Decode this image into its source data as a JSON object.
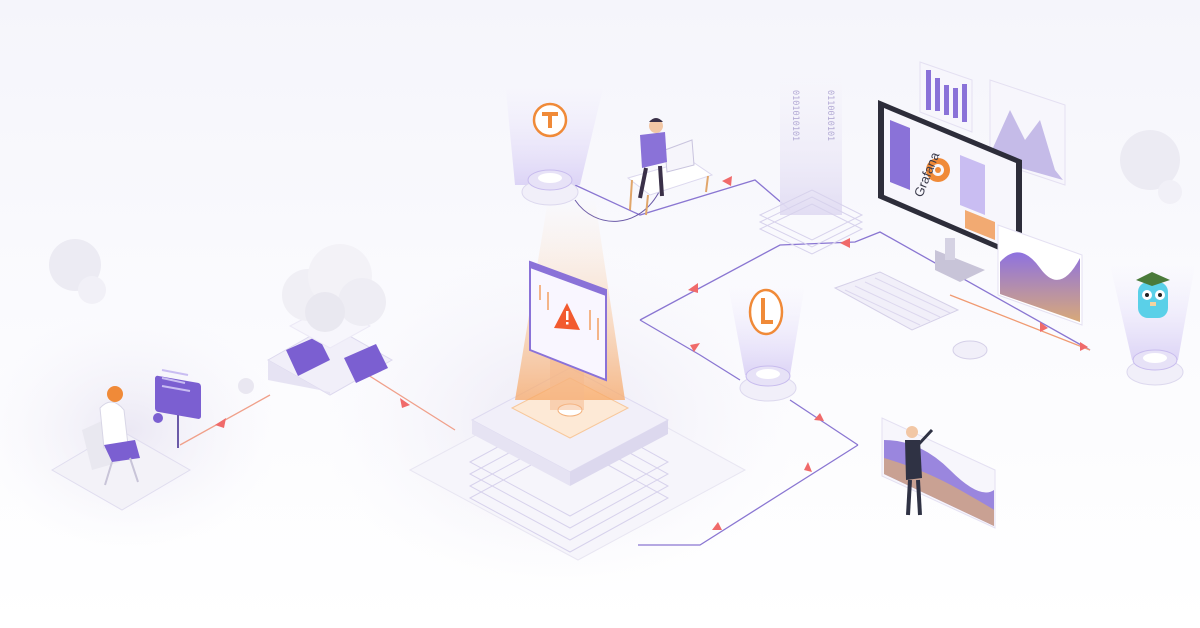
{
  "monitor": {
    "brand_text": "Grafana"
  },
  "servers": {
    "binary_left": "0101010101",
    "binary_right": "0110010101"
  },
  "colors": {
    "purple": "#7c5cd6",
    "purple_light": "#c9bdf2",
    "orange": "#f08a38",
    "arrow_red": "#f06a6a",
    "platform": "#eceaf6"
  },
  "icons": [
    "cloud-icon",
    "alert-warning-icon",
    "grafana-logo-icon",
    "timestream-icon",
    "influx-icon",
    "gopher-mascot-icon",
    "keyboard-icon",
    "mouse-icon",
    "monitor-icon"
  ]
}
